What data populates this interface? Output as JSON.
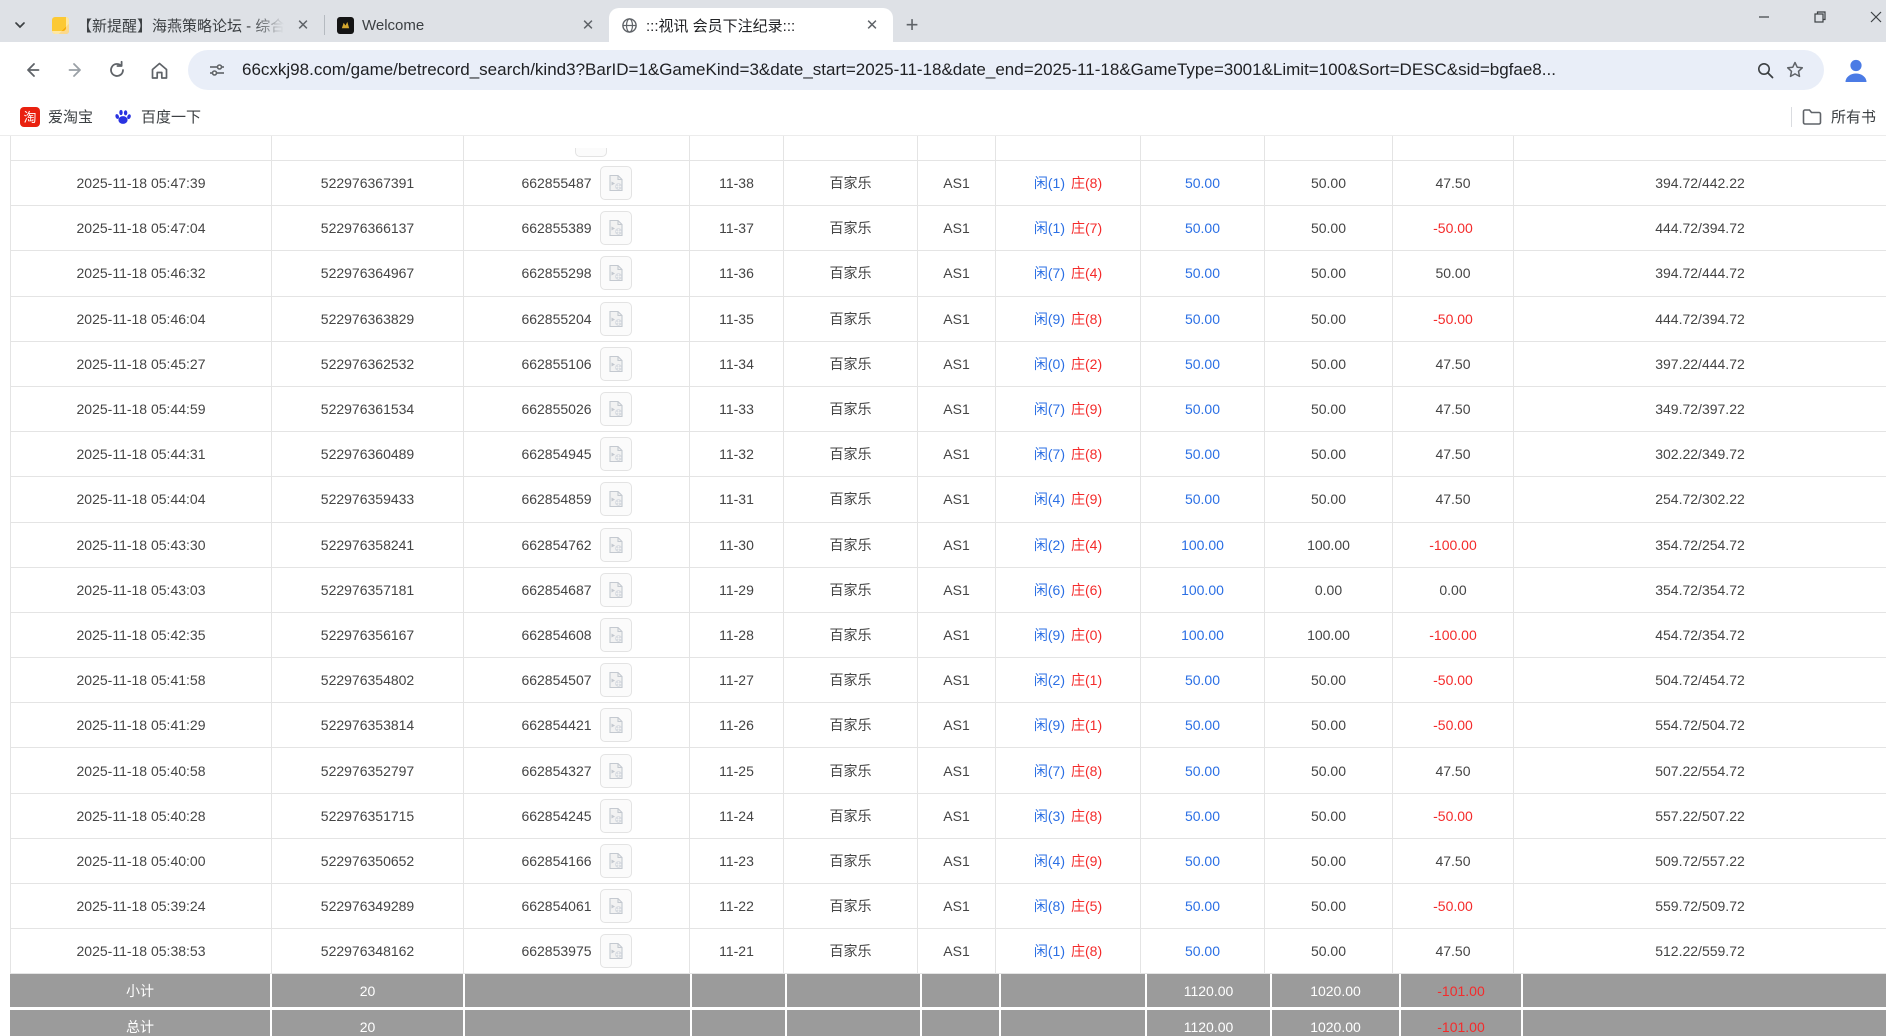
{
  "browser": {
    "tab_strip": {
      "tabs": [
        {
          "title": "【新提醒】海燕策略论坛 - 综合",
          "favicon": "yellow-note-icon",
          "active": false
        },
        {
          "title": "Welcome",
          "favicon": "gold-crest-icon",
          "active": false
        },
        {
          "title": ":::视讯 会员下注纪录:::",
          "favicon": "globe-icon",
          "active": true
        }
      ],
      "new_tab_glyph": "+",
      "close_glyph": "✕"
    },
    "toolbar": {
      "url": "66cxkj98.com/game/betrecord_search/kind3?BarID=1&GameKind=3&date_start=2025-11-18&date_end=2025-11-18&GameType=3001&Limit=100&Sort=DESC&sid=bgfae8..."
    },
    "bookmarks_bar": {
      "items": [
        {
          "label": "爱淘宝",
          "icon": "taobao-icon",
          "icon_glyph": "淘"
        },
        {
          "label": "百度一下",
          "icon": "baidu-paw-icon"
        }
      ],
      "all_bookmarks_label": "所有书"
    }
  },
  "page": {
    "colors": {
      "link_blue": "#2b6fe4",
      "loss_red": "#f42b2b",
      "footer_gray": "#9b9b9b"
    },
    "table": {
      "rows": [
        {
          "time": "2025-11-18 05:47:39",
          "bet_id": "522976367391",
          "round_id": "662855487",
          "round_no": "11-38",
          "game": "百家乐",
          "table": "AS1",
          "xian": "闲(1)",
          "zhuang": "庄(8)",
          "bet": "50.00",
          "valid": "50.00",
          "winloss": "47.50",
          "balance": "394.72/442.22"
        },
        {
          "time": "2025-11-18 05:47:04",
          "bet_id": "522976366137",
          "round_id": "662855389",
          "round_no": "11-37",
          "game": "百家乐",
          "table": "AS1",
          "xian": "闲(1)",
          "zhuang": "庄(7)",
          "bet": "50.00",
          "valid": "50.00",
          "winloss": "-50.00",
          "balance": "444.72/394.72"
        },
        {
          "time": "2025-11-18 05:46:32",
          "bet_id": "522976364967",
          "round_id": "662855298",
          "round_no": "11-36",
          "game": "百家乐",
          "table": "AS1",
          "xian": "闲(7)",
          "zhuang": "庄(4)",
          "bet": "50.00",
          "valid": "50.00",
          "winloss": "50.00",
          "balance": "394.72/444.72"
        },
        {
          "time": "2025-11-18 05:46:04",
          "bet_id": "522976363829",
          "round_id": "662855204",
          "round_no": "11-35",
          "game": "百家乐",
          "table": "AS1",
          "xian": "闲(9)",
          "zhuang": "庄(8)",
          "bet": "50.00",
          "valid": "50.00",
          "winloss": "-50.00",
          "balance": "444.72/394.72"
        },
        {
          "time": "2025-11-18 05:45:27",
          "bet_id": "522976362532",
          "round_id": "662855106",
          "round_no": "11-34",
          "game": "百家乐",
          "table": "AS1",
          "xian": "闲(0)",
          "zhuang": "庄(2)",
          "bet": "50.00",
          "valid": "50.00",
          "winloss": "47.50",
          "balance": "397.22/444.72"
        },
        {
          "time": "2025-11-18 05:44:59",
          "bet_id": "522976361534",
          "round_id": "662855026",
          "round_no": "11-33",
          "game": "百家乐",
          "table": "AS1",
          "xian": "闲(7)",
          "zhuang": "庄(9)",
          "bet": "50.00",
          "valid": "50.00",
          "winloss": "47.50",
          "balance": "349.72/397.22"
        },
        {
          "time": "2025-11-18 05:44:31",
          "bet_id": "522976360489",
          "round_id": "662854945",
          "round_no": "11-32",
          "game": "百家乐",
          "table": "AS1",
          "xian": "闲(7)",
          "zhuang": "庄(8)",
          "bet": "50.00",
          "valid": "50.00",
          "winloss": "47.50",
          "balance": "302.22/349.72"
        },
        {
          "time": "2025-11-18 05:44:04",
          "bet_id": "522976359433",
          "round_id": "662854859",
          "round_no": "11-31",
          "game": "百家乐",
          "table": "AS1",
          "xian": "闲(4)",
          "zhuang": "庄(9)",
          "bet": "50.00",
          "valid": "50.00",
          "winloss": "47.50",
          "balance": "254.72/302.22"
        },
        {
          "time": "2025-11-18 05:43:30",
          "bet_id": "522976358241",
          "round_id": "662854762",
          "round_no": "11-30",
          "game": "百家乐",
          "table": "AS1",
          "xian": "闲(2)",
          "zhuang": "庄(4)",
          "bet": "100.00",
          "valid": "100.00",
          "winloss": "-100.00",
          "balance": "354.72/254.72"
        },
        {
          "time": "2025-11-18 05:43:03",
          "bet_id": "522976357181",
          "round_id": "662854687",
          "round_no": "11-29",
          "game": "百家乐",
          "table": "AS1",
          "xian": "闲(6)",
          "zhuang": "庄(6)",
          "bet": "100.00",
          "valid": "0.00",
          "winloss": "0.00",
          "balance": "354.72/354.72"
        },
        {
          "time": "2025-11-18 05:42:35",
          "bet_id": "522976356167",
          "round_id": "662854608",
          "round_no": "11-28",
          "game": "百家乐",
          "table": "AS1",
          "xian": "闲(9)",
          "zhuang": "庄(0)",
          "bet": "100.00",
          "valid": "100.00",
          "winloss": "-100.00",
          "balance": "454.72/354.72"
        },
        {
          "time": "2025-11-18 05:41:58",
          "bet_id": "522976354802",
          "round_id": "662854507",
          "round_no": "11-27",
          "game": "百家乐",
          "table": "AS1",
          "xian": "闲(2)",
          "zhuang": "庄(1)",
          "bet": "50.00",
          "valid": "50.00",
          "winloss": "-50.00",
          "balance": "504.72/454.72"
        },
        {
          "time": "2025-11-18 05:41:29",
          "bet_id": "522976353814",
          "round_id": "662854421",
          "round_no": "11-26",
          "game": "百家乐",
          "table": "AS1",
          "xian": "闲(9)",
          "zhuang": "庄(1)",
          "bet": "50.00",
          "valid": "50.00",
          "winloss": "-50.00",
          "balance": "554.72/504.72"
        },
        {
          "time": "2025-11-18 05:40:58",
          "bet_id": "522976352797",
          "round_id": "662854327",
          "round_no": "11-25",
          "game": "百家乐",
          "table": "AS1",
          "xian": "闲(7)",
          "zhuang": "庄(8)",
          "bet": "50.00",
          "valid": "50.00",
          "winloss": "47.50",
          "balance": "507.22/554.72"
        },
        {
          "time": "2025-11-18 05:40:28",
          "bet_id": "522976351715",
          "round_id": "662854245",
          "round_no": "11-24",
          "game": "百家乐",
          "table": "AS1",
          "xian": "闲(3)",
          "zhuang": "庄(8)",
          "bet": "50.00",
          "valid": "50.00",
          "winloss": "-50.00",
          "balance": "557.22/507.22"
        },
        {
          "time": "2025-11-18 05:40:00",
          "bet_id": "522976350652",
          "round_id": "662854166",
          "round_no": "11-23",
          "game": "百家乐",
          "table": "AS1",
          "xian": "闲(4)",
          "zhuang": "庄(9)",
          "bet": "50.00",
          "valid": "50.00",
          "winloss": "47.50",
          "balance": "509.72/557.22"
        },
        {
          "time": "2025-11-18 05:39:24",
          "bet_id": "522976349289",
          "round_id": "662854061",
          "round_no": "11-22",
          "game": "百家乐",
          "table": "AS1",
          "xian": "闲(8)",
          "zhuang": "庄(5)",
          "bet": "50.00",
          "valid": "50.00",
          "winloss": "-50.00",
          "balance": "559.72/509.72"
        },
        {
          "time": "2025-11-18 05:38:53",
          "bet_id": "522976348162",
          "round_id": "662853975",
          "round_no": "11-21",
          "game": "百家乐",
          "table": "AS1",
          "xian": "闲(1)",
          "zhuang": "庄(8)",
          "bet": "50.00",
          "valid": "50.00",
          "winloss": "47.50",
          "balance": "512.22/559.72"
        }
      ],
      "footer": [
        {
          "label": "小计",
          "count": "20",
          "bet": "1120.00",
          "valid": "1020.00",
          "winloss": "-101.00"
        },
        {
          "label": "总计",
          "count": "20",
          "bet": "1120.00",
          "valid": "1020.00",
          "winloss": "-101.00"
        }
      ]
    }
  }
}
